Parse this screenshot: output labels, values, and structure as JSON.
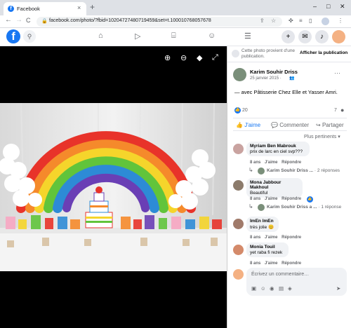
{
  "browser": {
    "tab_title": "Facebook",
    "tab_close": "×",
    "new_tab": "+",
    "url": "facebook.com/photo/?fbid=10204727480719459&set=t.100010768057678",
    "nav_back": "←",
    "nav_forward": "→",
    "nav_reload": "C",
    "window_min": "–",
    "window_max": "□",
    "window_close": "✕"
  },
  "fb": {
    "logo": "f",
    "search_icon": "search-icon",
    "messenger_icon": "messenger-icon",
    "notifications_icon": "bell-icon"
  },
  "panel": {
    "notice_text": "Cette photo provient d'une publication.",
    "notice_button": "Afficher la publication",
    "poster_name": "Karim Souhir Driss",
    "poster_date": "25 janvier 2015 ·",
    "caption": "— avec Pâtisserie Chez Elle et Yasser Amri.",
    "reaction_count": "20",
    "comment_count": "7",
    "actions": {
      "like": "J'aime",
      "comment": "Commenter",
      "share": "Partager"
    },
    "sort": "Plus pertinents ▾",
    "composer_placeholder": "Écrivez un commentaire…"
  },
  "comments": [
    {
      "name": "Myriam Ben Mabrouk",
      "text": "prix de larc en ciel svp???",
      "time": "8 ans",
      "like": "J'aime",
      "reply": "Répondre",
      "reply_author": "Karim Souhir Driss ...",
      "reply_count": "· 2 réponses"
    },
    {
      "name": "Mona Jabbour Makhoul",
      "text": "Beautiful",
      "time": "8 ans",
      "like": "J'aime",
      "reply": "Répondre",
      "reply_author": "Karim Souhir Driss a ...",
      "reply_count": "· 1 réponse"
    },
    {
      "name": "ImEn ImEn",
      "text": "très jolie 😊",
      "time": "8 ans",
      "like": "J'aime",
      "reply": "Répondre"
    },
    {
      "name": "Monia Touil",
      "text": "yet raba fi rezek",
      "time": "8 ans",
      "like": "J'aime",
      "reply": "Répondre"
    }
  ],
  "colors": {
    "brand": "#1877f2",
    "viewer_bg": "#000000"
  }
}
